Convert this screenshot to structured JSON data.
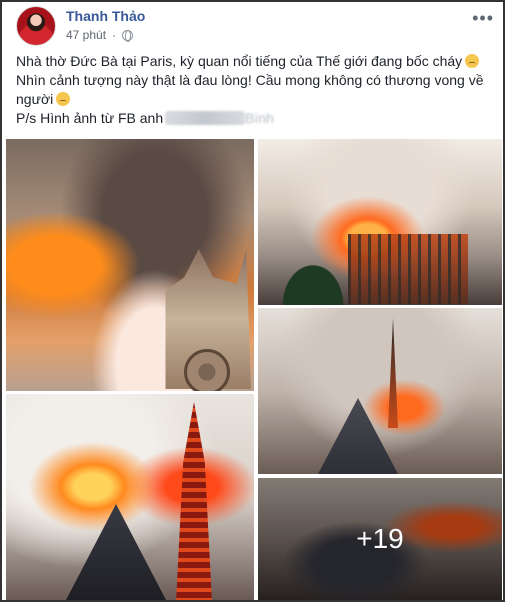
{
  "post": {
    "author": "Thanh Thảo",
    "time": "47 phút",
    "privacy_icon": "globe-icon",
    "more_icon": "ellipsis-icon",
    "text_line1": "Nhà thờ Đức Bà tại Paris, kỳ quan nổi tiếng của Thế giới đang bốc cháy",
    "text_line2": "Nhìn cảnh tượng này thật là đau lòng! Cầu mong không có thương vong về người",
    "text_line3": "P/s Hình ảnh từ FB anh",
    "text_line3_suffix": "Bình",
    "emoji": "disappointed-face-icon"
  },
  "photos": {
    "more_count": "+19"
  },
  "colors": {
    "author_link": "#385898",
    "meta_text": "#616770",
    "body_text": "#1d2129",
    "border": "#333333"
  }
}
